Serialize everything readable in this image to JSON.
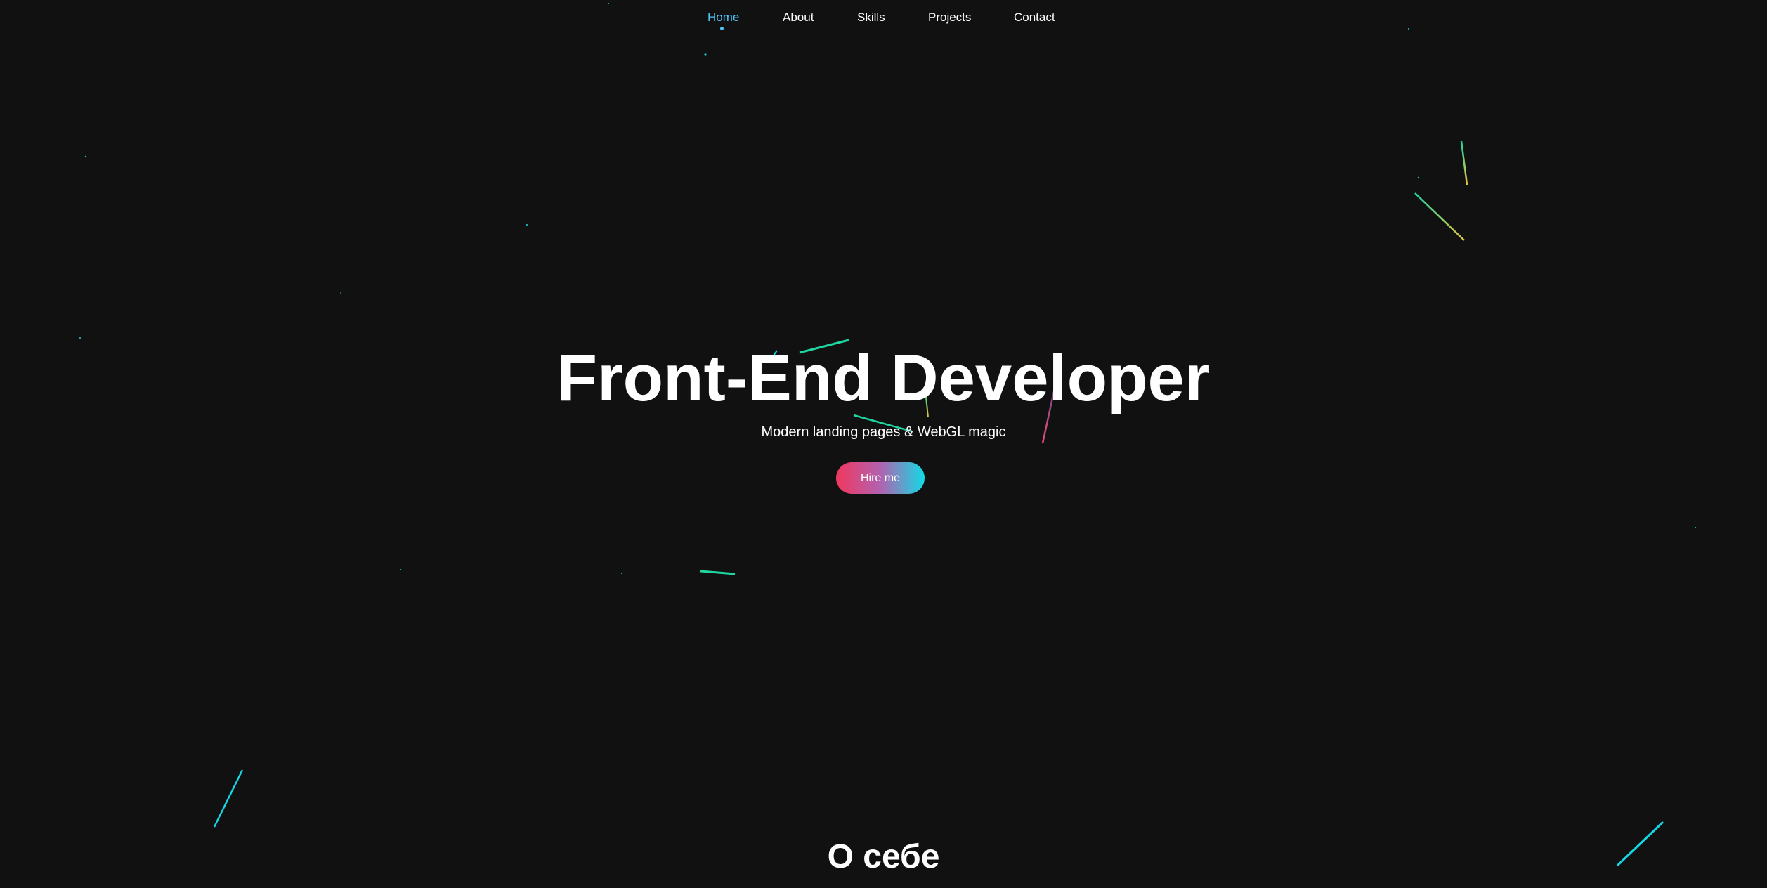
{
  "colors": {
    "background": "#111111",
    "nav_active": "#4fc3f7",
    "text": "#ffffff",
    "button_gradient_start": "#f0375f",
    "button_gradient_end": "#12dbe6",
    "particle_cyan": "#14d8e3",
    "particle_green": "#1fd6a2",
    "particle_yellow": "#e3c43a",
    "particle_pink": "#e94b6f"
  },
  "nav": {
    "items": [
      {
        "label": "Home",
        "active": true
      },
      {
        "label": "About",
        "active": false
      },
      {
        "label": "Skills",
        "active": false
      },
      {
        "label": "Projects",
        "active": false
      },
      {
        "label": "Contact",
        "active": false
      }
    ]
  },
  "hero": {
    "title": "Front-End Developer",
    "subtitle": "Modern landing pages & WebGL magic",
    "cta_label": "Hire me"
  },
  "about": {
    "heading": "О себе"
  }
}
